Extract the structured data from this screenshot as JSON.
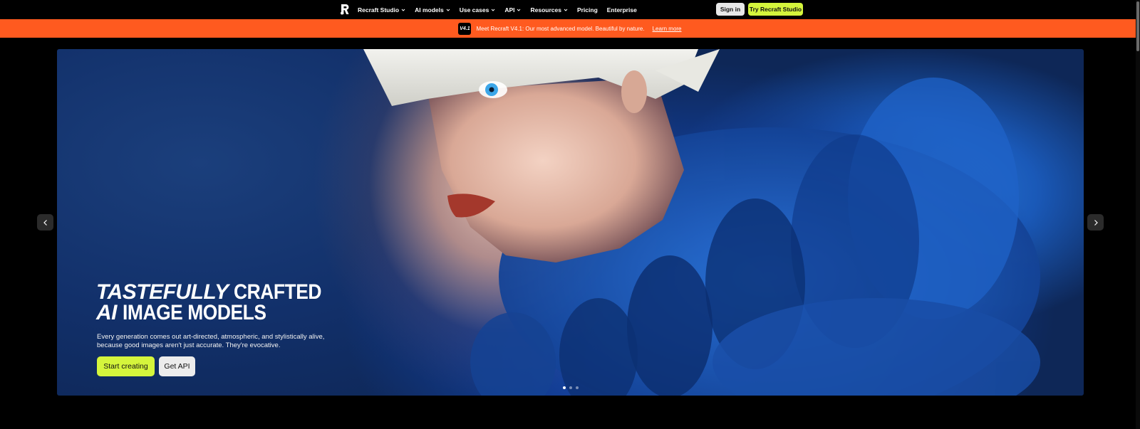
{
  "nav": {
    "items": [
      {
        "label": "Recraft Studio",
        "dropdown": true
      },
      {
        "label": "AI models",
        "dropdown": true
      },
      {
        "label": "Use cases",
        "dropdown": true
      },
      {
        "label": "API",
        "dropdown": true
      },
      {
        "label": "Resources",
        "dropdown": true
      },
      {
        "label": "Pricing",
        "dropdown": false
      },
      {
        "label": "Enterprise",
        "dropdown": false
      }
    ],
    "sign_in": "Sign in",
    "try": "Try Recraft Studio"
  },
  "banner": {
    "badge": "V4.1",
    "text": "Meet Recraft V4.1: Our most advanced model. Beautiful by nature.",
    "link": "Learn more"
  },
  "hero": {
    "title_l1_a": "TASTEFULLY",
    "title_l1_b": "CRAFTED",
    "title_l2_a": "AI",
    "title_l2_b": "IMAGE MODELS",
    "description": "Every generation comes out art-directed, atmospheric, and stylistically alive, because good images aren't just accurate. They're evocative.",
    "start_button": "Start creating",
    "api_button": "Get API",
    "slides_total": 3,
    "slide_active": 1
  },
  "colors": {
    "accent": "#d5f53c",
    "banner": "#ff5a1f",
    "background": "#000000"
  }
}
